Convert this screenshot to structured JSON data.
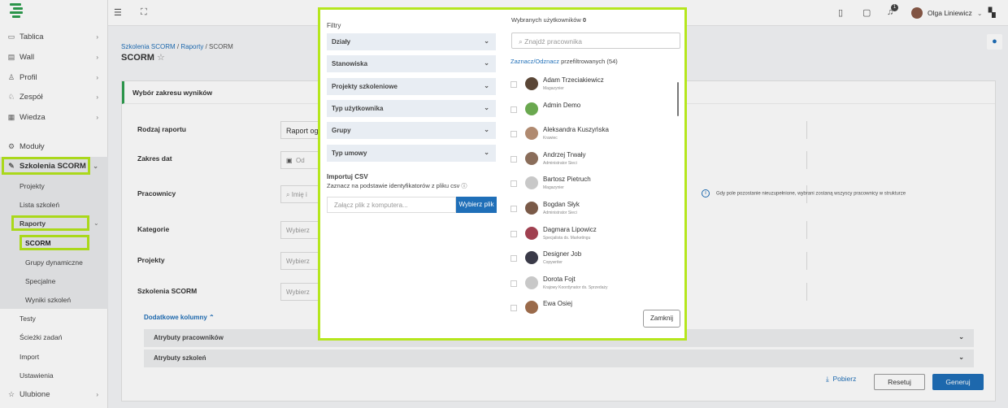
{
  "sidebar": {
    "items": [
      {
        "label": "Tablica",
        "icon": "monitor-icon"
      },
      {
        "label": "Wall",
        "icon": "wall-icon"
      },
      {
        "label": "Profil",
        "icon": "user-icon"
      },
      {
        "label": "Zespół",
        "icon": "team-icon"
      },
      {
        "label": "Wiedza",
        "icon": "knowledge-icon"
      },
      {
        "label": "Moduły",
        "icon": "modules-icon"
      },
      {
        "label": "Szkolenia SCORM",
        "icon": "wrench-icon"
      }
    ],
    "scorm_sub": [
      "Projekty",
      "Lista szkoleń"
    ],
    "raporty": "Raporty",
    "raporty_sub": [
      "SCORM",
      "Grupy dynamiczne",
      "Specjalne",
      "Wyniki szkoleń"
    ],
    "other": [
      "Testy",
      "Ścieżki zadań",
      "Import",
      "Ustawienia"
    ],
    "ulubione": "Ulubione"
  },
  "topbar": {
    "user_name": "Olga Liniewicz",
    "notification_count": "1"
  },
  "header": {
    "crumb1": "Szkolenia SCORM",
    "crumb2": "Raporty",
    "crumb3": "SCORM",
    "title": "SCORM"
  },
  "card": {
    "head": "Wybór zakresu wyników",
    "rows": {
      "rodzaj": "Rodzaj raportu",
      "zakres": "Zakres dat",
      "pracownicy": "Pracownicy",
      "kategorie": "Kategorie",
      "projekty": "Projekty",
      "szkolenia": "Szkolenia SCORM"
    },
    "rodzaj_value": "Raport og",
    "date_from": "Od",
    "pracownicy_placeholder": "Imię i",
    "wybierz": "Wybierz",
    "note": "Gdy pole pozostanie nieuzupełnione, wybrani zostaną wszyscy pracownicy w strukturze",
    "dodatkowe": "Dodatkowe kolumny",
    "acc1": "Atrybuty pracowników",
    "acc2": "Atrybuty szkoleń",
    "pobierz": "Pobierz",
    "resetuj": "Resetuj",
    "generuj": "Generuj"
  },
  "modal": {
    "filtry": "Filtry",
    "filters": [
      "Działy",
      "Stanowiska",
      "Projekty szkoleniowe",
      "Typ użytkownika",
      "Grupy",
      "Typ umowy"
    ],
    "import_title": "Importuj CSV",
    "import_desc": "Zaznacz na podstawie identyfikatorów z pliku csv",
    "csv_placeholder": "Załącz plik z komputera...",
    "csv_button": "Wybierz plik",
    "selected_label": "Wybranych użytkowników",
    "selected_count": "0",
    "search_placeholder": "Znajdź pracownika",
    "select_toggle": "Zaznacz/Odznacz",
    "filtered_label": "przefiltrowanych (54)",
    "users": [
      {
        "name": "Adam Trzeciakiewicz",
        "role": "Magazynier",
        "color": "#5a4636"
      },
      {
        "name": "Admin Demo",
        "role": "",
        "color": "#6aa84f"
      },
      {
        "name": "Aleksandra Kuszyńska",
        "role": "Krawiec",
        "color": "#b08a70"
      },
      {
        "name": "Andrzej Trwały",
        "role": "Administrator Sieci",
        "color": "#8a6d5a"
      },
      {
        "name": "Bartosz Pietruch",
        "role": "Magazynier",
        "color": "#c8c8c8"
      },
      {
        "name": "Bogdan Słyk",
        "role": "Administrator Sieci",
        "color": "#7a5a48"
      },
      {
        "name": "Dagmara Lipowicz",
        "role": "Specjalista ds. Marketingu",
        "color": "#a04050"
      },
      {
        "name": "Designer Job",
        "role": "Copywriter",
        "color": "#3a3a48"
      },
      {
        "name": "Dorota Fojt",
        "role": "Krajowy Koordynator ds. Sprzedaży",
        "color": "#c8c8c8"
      },
      {
        "name": "Ewa Osiej",
        "role": "",
        "color": "#9a6a4a"
      }
    ],
    "close": "Zamknij"
  }
}
